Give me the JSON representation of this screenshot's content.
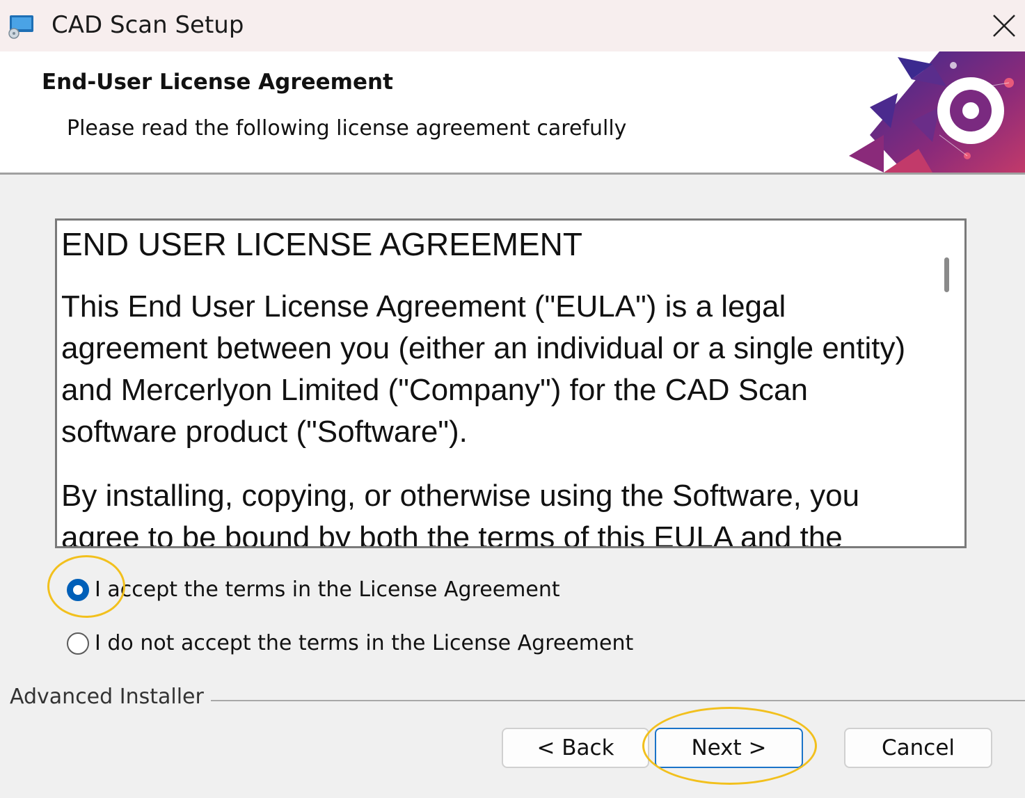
{
  "window": {
    "title": "CAD Scan Setup",
    "close_icon": "close-icon",
    "app_icon": "installer-app-icon"
  },
  "header": {
    "title": "End-User License Agreement",
    "subtitle": "Please read the following license agreement carefully",
    "banner_colors": [
      "#3b2a8f",
      "#8a2a7a",
      "#c23a6a",
      "#e85a7a"
    ]
  },
  "eula": {
    "heading": "END USER LICENSE AGREEMENT",
    "paragraph1": "This End User License Agreement (\"EULA\") is a legal agreement between you (either an individual or a single entity) and Mercerlyon Limited (\"Company\") for the CAD Scan software product (\"Software\").",
    "paragraph2": "By installing, copying, or otherwise using the Software, you agree to be bound by both the terms of this EULA and the"
  },
  "options": {
    "accept": {
      "label": "I accept the terms in the License Agreement",
      "selected": true
    },
    "decline": {
      "label": "I do not accept the terms in the License Agreement",
      "selected": false
    }
  },
  "footer": {
    "brand": "Advanced Installer",
    "back_label": "< Back",
    "next_label": "Next >",
    "cancel_label": "Cancel"
  },
  "colors": {
    "accent": "#005fb8",
    "highlight": "#f2c01d"
  }
}
